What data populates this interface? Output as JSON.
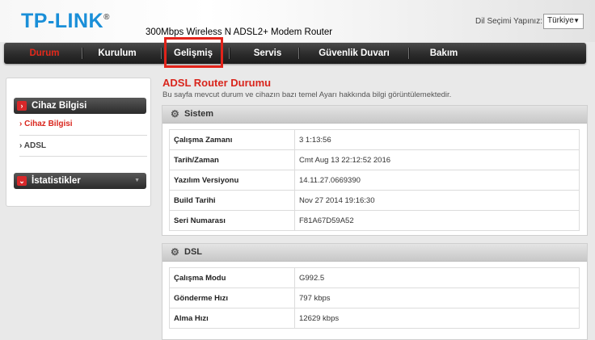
{
  "header": {
    "logo": "TP-LINK",
    "logo_mark": "®",
    "model": "300Mbps Wireless N ADSL2+ Modem Router",
    "lang_label": "Dil Seçimi Yapınız:",
    "lang_value": "Türkiye"
  },
  "nav": {
    "items": [
      "Durum",
      "Kurulum",
      "Gelişmiş",
      "Servis",
      "Güvenlik Duvarı",
      "Bakım"
    ]
  },
  "sidebar": {
    "section1": "Cihaz Bilgisi",
    "items": [
      "Cihaz Bilgisi",
      "ADSL"
    ],
    "section2": "İstatistikler"
  },
  "main": {
    "title": "ADSL Router Durumu",
    "description": "Bu sayfa mevcut durum ve cihazın bazı temel Ayarı hakkında bilgi görüntülemektedir."
  },
  "system": {
    "title": "Sistem",
    "rows": [
      {
        "key": "Çalışma Zamanı",
        "value": "3 1:13:56"
      },
      {
        "key": "Tarih/Zaman",
        "value": "Cmt Aug 13 22:12:52 2016"
      },
      {
        "key": "Yazılım Versiyonu",
        "value": "14.11.27.0669390"
      },
      {
        "key": "Build Tarihi",
        "value": "Nov 27 2014 19:16:30"
      },
      {
        "key": "Seri Numarası",
        "value": "F81A67D59A52"
      }
    ]
  },
  "dsl": {
    "title": "DSL",
    "rows": [
      {
        "key": "Çalışma Modu",
        "value": "G992.5"
      },
      {
        "key": "Gönderme Hızı",
        "value": "797 kbps"
      },
      {
        "key": "Alma Hızı",
        "value": "12629 kbps"
      }
    ]
  },
  "colors": {
    "accent": "#d9251c",
    "logo": "#1a8fd8",
    "highlight": "#e2231a",
    "navbar": "#2b2b2b"
  }
}
